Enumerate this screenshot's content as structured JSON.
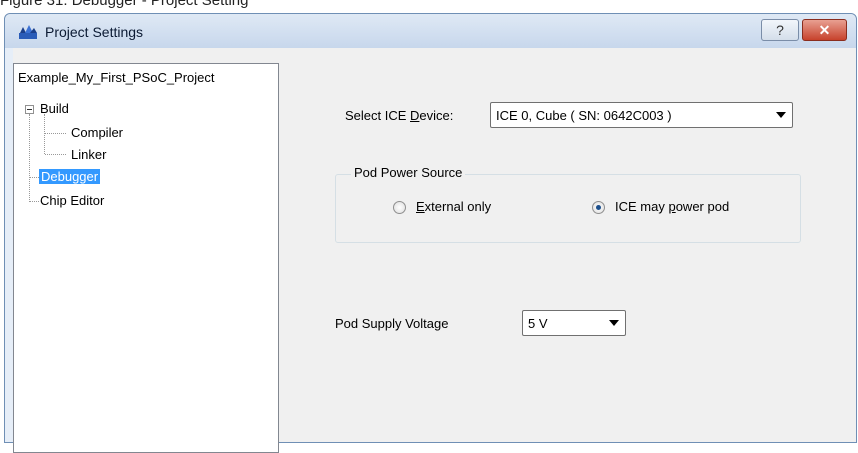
{
  "caption": "Figure 31.  Debugger - Project Setting",
  "window": {
    "title": "Project Settings",
    "help_label": "?",
    "close_label": "✕"
  },
  "tree": {
    "root": "Example_My_First_PSoC_Project",
    "build": "Build",
    "compiler": "Compiler",
    "linker": "Linker",
    "debugger": "Debugger",
    "chip_editor": "Chip Editor"
  },
  "debugger": {
    "ice_device_label_pre": "Select ICE ",
    "ice_device_label_u": "D",
    "ice_device_label_post": "evice:",
    "ice_device_value": "ICE 0, Cube ( SN: 0642C003 )",
    "pod_power": {
      "title": "Pod Power Source",
      "external_u": "E",
      "external_rest": "xternal only",
      "ice_pre": "ICE may ",
      "ice_u": "p",
      "ice_post": "ower pod",
      "selected": "ICE may power pod"
    },
    "pod_voltage_label": "Pod Supply Voltage",
    "pod_voltage_value": "5 V"
  },
  "colors": {
    "selection": "#3399ff",
    "close_button": "#c7422c"
  }
}
